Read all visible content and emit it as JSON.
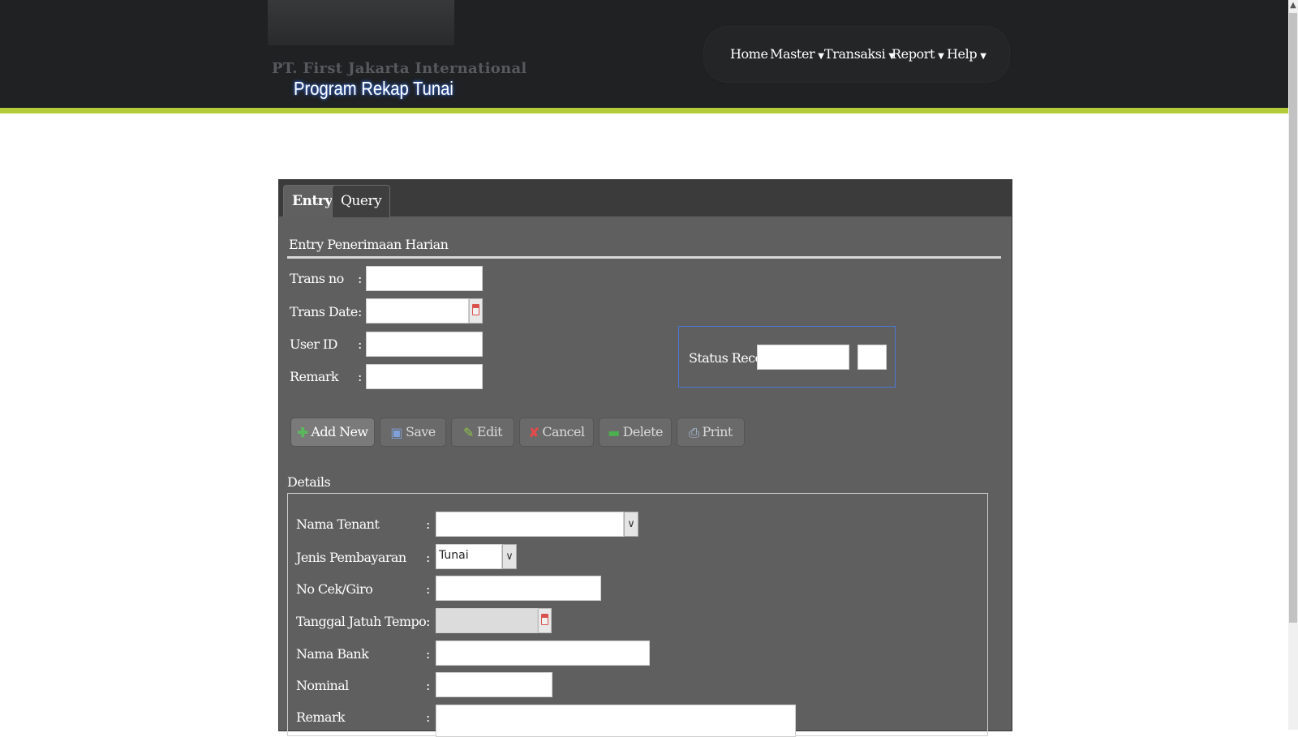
{
  "header": {
    "company": "PT. First Jakarta International",
    "title": "Program Rekap Tunai"
  },
  "nav": {
    "items": [
      {
        "label": "Home",
        "dropdown": false
      },
      {
        "label": "Master",
        "dropdown": true
      },
      {
        "label": "Transaksi",
        "dropdown": true
      },
      {
        "label": "Report",
        "dropdown": true
      },
      {
        "label": "Help",
        "dropdown": true
      }
    ]
  },
  "tabs": [
    {
      "label": "Entry",
      "active": true
    },
    {
      "label": "Query",
      "active": false
    }
  ],
  "entry": {
    "section_title": "Entry Penerimaan Harian",
    "trans_no_label": "Trans no",
    "trans_date_label": "Trans Date",
    "user_id_label": "User ID",
    "remark_label": "Remark",
    "colon": ":",
    "trans_no_value": "",
    "trans_date_value": "",
    "user_id_value": "",
    "remark_value": "",
    "status_record_label": "Status Record :",
    "status_record_value": "",
    "status_record_code": ""
  },
  "buttons": {
    "add_new": "Add New",
    "save": "Save",
    "edit": "Edit",
    "cancel": "Cancel",
    "delete": "Delete",
    "print": "Print"
  },
  "details": {
    "title": "Details",
    "nama_tenant_label": "Nama Tenant",
    "jenis_pembayaran_label": "Jenis Pembayaran",
    "no_cek_giro_label": "No Cek/Giro",
    "tanggal_jatuh_tempo_label": "Tanggal Jatuh Tempo",
    "nama_bank_label": "Nama Bank",
    "nominal_label": "Nominal",
    "remark_label": "Remark",
    "nama_tenant_value": "",
    "jenis_pembayaran_value": "Tunai",
    "no_cek_giro_value": "",
    "tanggal_jatuh_tempo_value": "",
    "nama_bank_value": "",
    "nominal_value": "",
    "remark_value": ""
  },
  "colors": {
    "header_bg": "#1f2122",
    "accent_line": "#b5cc3a",
    "panel_bg": "#5f5f5f",
    "status_border": "#4b78d6"
  }
}
